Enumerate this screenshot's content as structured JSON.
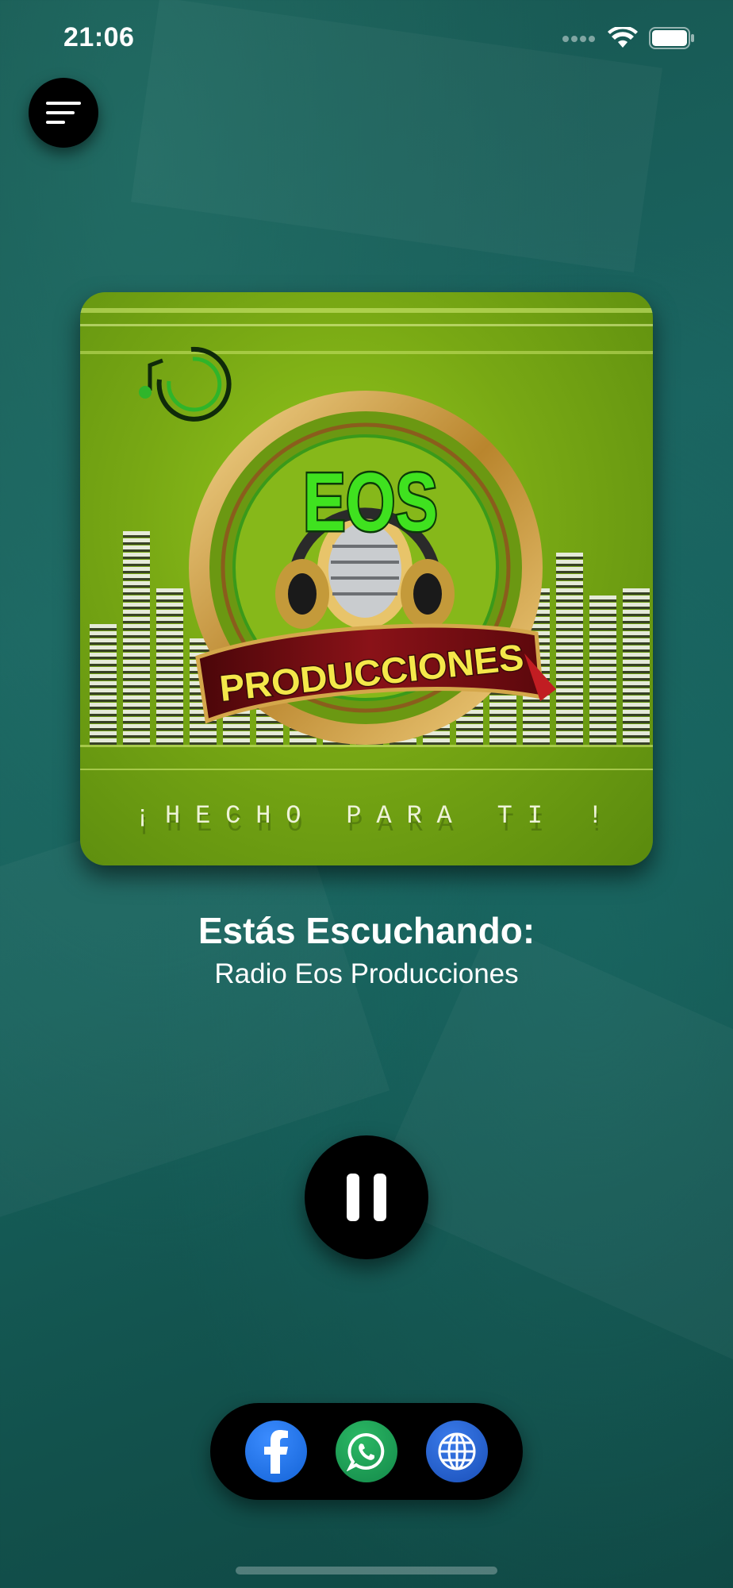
{
  "status_bar": {
    "time": "21:06",
    "battery_level": 1.0
  },
  "artwork": {
    "brand_name": "EOS",
    "banner_text": "PRODUCCIONES",
    "slogan": "¡HECHO PARA TI !",
    "colors": {
      "background": "#7fb21a",
      "brand_green": "#39e01c",
      "gold": "#c99a3c",
      "banner_red": "#7a0e14",
      "banner_text": "#f4e84a"
    }
  },
  "now_playing": {
    "label": "Estás Escuchando:",
    "station": "Radio Eos Producciones"
  },
  "player": {
    "state": "playing",
    "button_icon": "pause-icon"
  },
  "social": [
    {
      "name": "facebook",
      "icon": "facebook-icon",
      "color": "#1877f2"
    },
    {
      "name": "whatsapp",
      "icon": "whatsapp-icon",
      "color": "#1fa355"
    },
    {
      "name": "website",
      "icon": "globe-icon",
      "color": "#1f5fd0"
    }
  ]
}
